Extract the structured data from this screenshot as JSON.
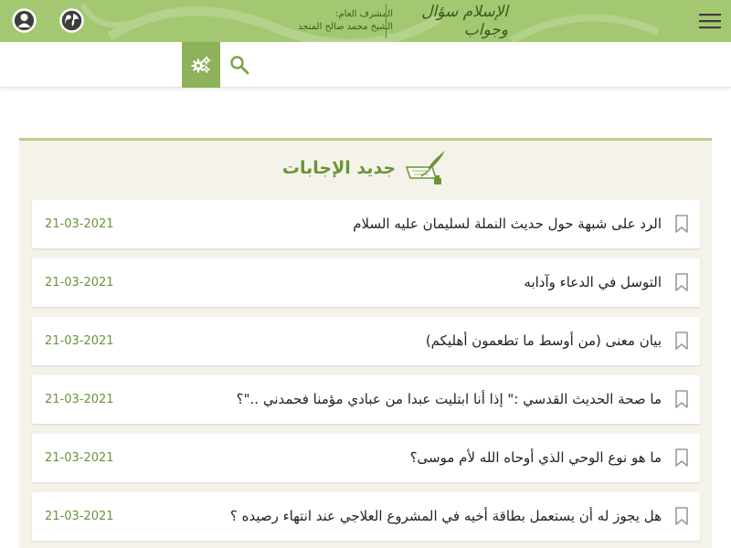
{
  "header": {
    "logo_text": "الإسلام سؤال وجواب",
    "supervisor_label": "المشرف العام:",
    "supervisor_name": "الشيخ محمد صالح المنجد",
    "icons": [
      "user-icon",
      "globe-icon",
      "hamburger-menu-icon"
    ],
    "background_color": "#a4c871"
  },
  "search": {
    "placeholder": "",
    "icons": [
      "gears-icon",
      "search-icon"
    ],
    "settings_color": "#8db25a"
  },
  "section": {
    "title": "جديد الإجابات",
    "icon": "quill-icon",
    "accent_color": "#6a9436"
  },
  "answers": [
    {
      "title": "الرد على شبهة حول حديث النملة لسليمان عليه السلام",
      "date": "21-03-2021"
    },
    {
      "title": "التوسل في الدعاء وآدابه",
      "date": "21-03-2021"
    },
    {
      "title": "بيان معنى (من أوسط ما تطعمون أهليكم)",
      "date": "21-03-2021"
    },
    {
      "title": "ما صحة الحديث القدسي :\" إذا أنا ابتليت عبدا من عبادي مؤمنا فحمدني ..\"؟",
      "date": "21-03-2021"
    },
    {
      "title": "ما هو نوع الوحي الذي أوحاه الله لأم موسى؟",
      "date": "21-03-2021"
    },
    {
      "title": "هل يجوز له أن يستعمل بطاقة أخيه في المشروع العلاجي عند انتهاء رصيده ؟",
      "date": "21-03-2021"
    }
  ]
}
